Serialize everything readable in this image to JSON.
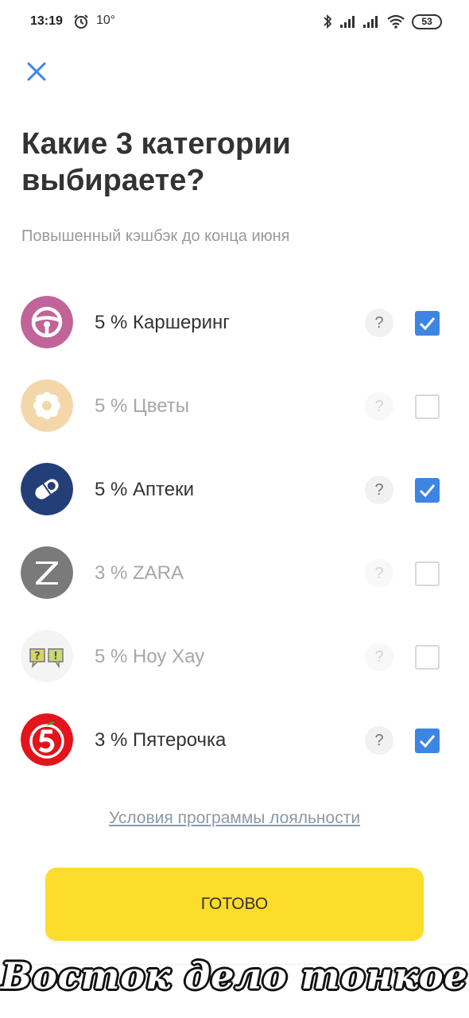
{
  "status_bar": {
    "time": "13:19",
    "temperature": "10°",
    "battery": "53"
  },
  "close_icon": "close-icon",
  "title": "Какие 3 категории выбираете?",
  "subtitle": "Повышенный кэшбэк до конца июня",
  "categories": [
    {
      "label": "5 % Каршеринг",
      "icon": "steering-wheel-icon",
      "checked": true,
      "color": "#c0649a"
    },
    {
      "label": "5 % Цветы",
      "icon": "flower-icon",
      "checked": false,
      "color": "#f3d7aa"
    },
    {
      "label": "5 % Аптеки",
      "icon": "pill-icon",
      "checked": true,
      "color": "#243f78"
    },
    {
      "label": "3 % ZARA",
      "icon": "zara-z-icon",
      "checked": false,
      "color": "#7a7a7a"
    },
    {
      "label": "5 % Ноу Хау",
      "icon": "speech-bubbles-icon",
      "checked": false,
      "color": "#f4f4f4"
    },
    {
      "label": "3 % Пятерочка",
      "icon": "pyaterochka-logo-icon",
      "checked": true,
      "color": "#e3141b"
    }
  ],
  "help_label": "?",
  "terms_link": "Условия программы лояльности",
  "done_button": "ГОТОВО",
  "watermark": "Восток дело тонкое",
  "colors": {
    "accent": "#3c85e3",
    "button": "#fcdd2b"
  }
}
